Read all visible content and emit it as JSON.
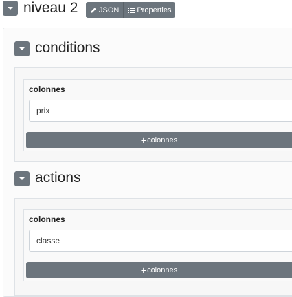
{
  "header": {
    "title": "niveau 2",
    "json_label": "JSON",
    "properties_label": "Properties"
  },
  "sections": [
    {
      "title": "conditions",
      "field_label": "colonnes",
      "input_value": "prix",
      "add_plus": "+",
      "add_label": "colonnes"
    },
    {
      "title": "actions",
      "field_label": "colonnes",
      "input_value": "classe",
      "add_plus": "+",
      "add_label": "colonnes"
    }
  ],
  "colors": {
    "button_bg": "#6c757d",
    "border": "#dee2e6"
  },
  "icons": {
    "toggle": "chevron-down-icon",
    "json": "pencil-icon",
    "properties": "list-icon"
  }
}
